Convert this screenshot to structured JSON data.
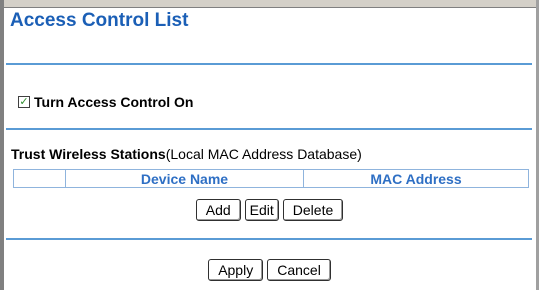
{
  "title": "Access Control List",
  "access_control": {
    "label": "Turn Access Control On",
    "checked": true
  },
  "trust_section": {
    "heading": "Trust Wireless Stations",
    "subheading": "(Local MAC Address Database)"
  },
  "table": {
    "columns": [
      "",
      "Device Name",
      "MAC Address"
    ]
  },
  "list_buttons": {
    "add": "Add",
    "edit": "Edit",
    "delete": "Delete"
  },
  "form_buttons": {
    "apply": "Apply",
    "cancel": "Cancel"
  }
}
